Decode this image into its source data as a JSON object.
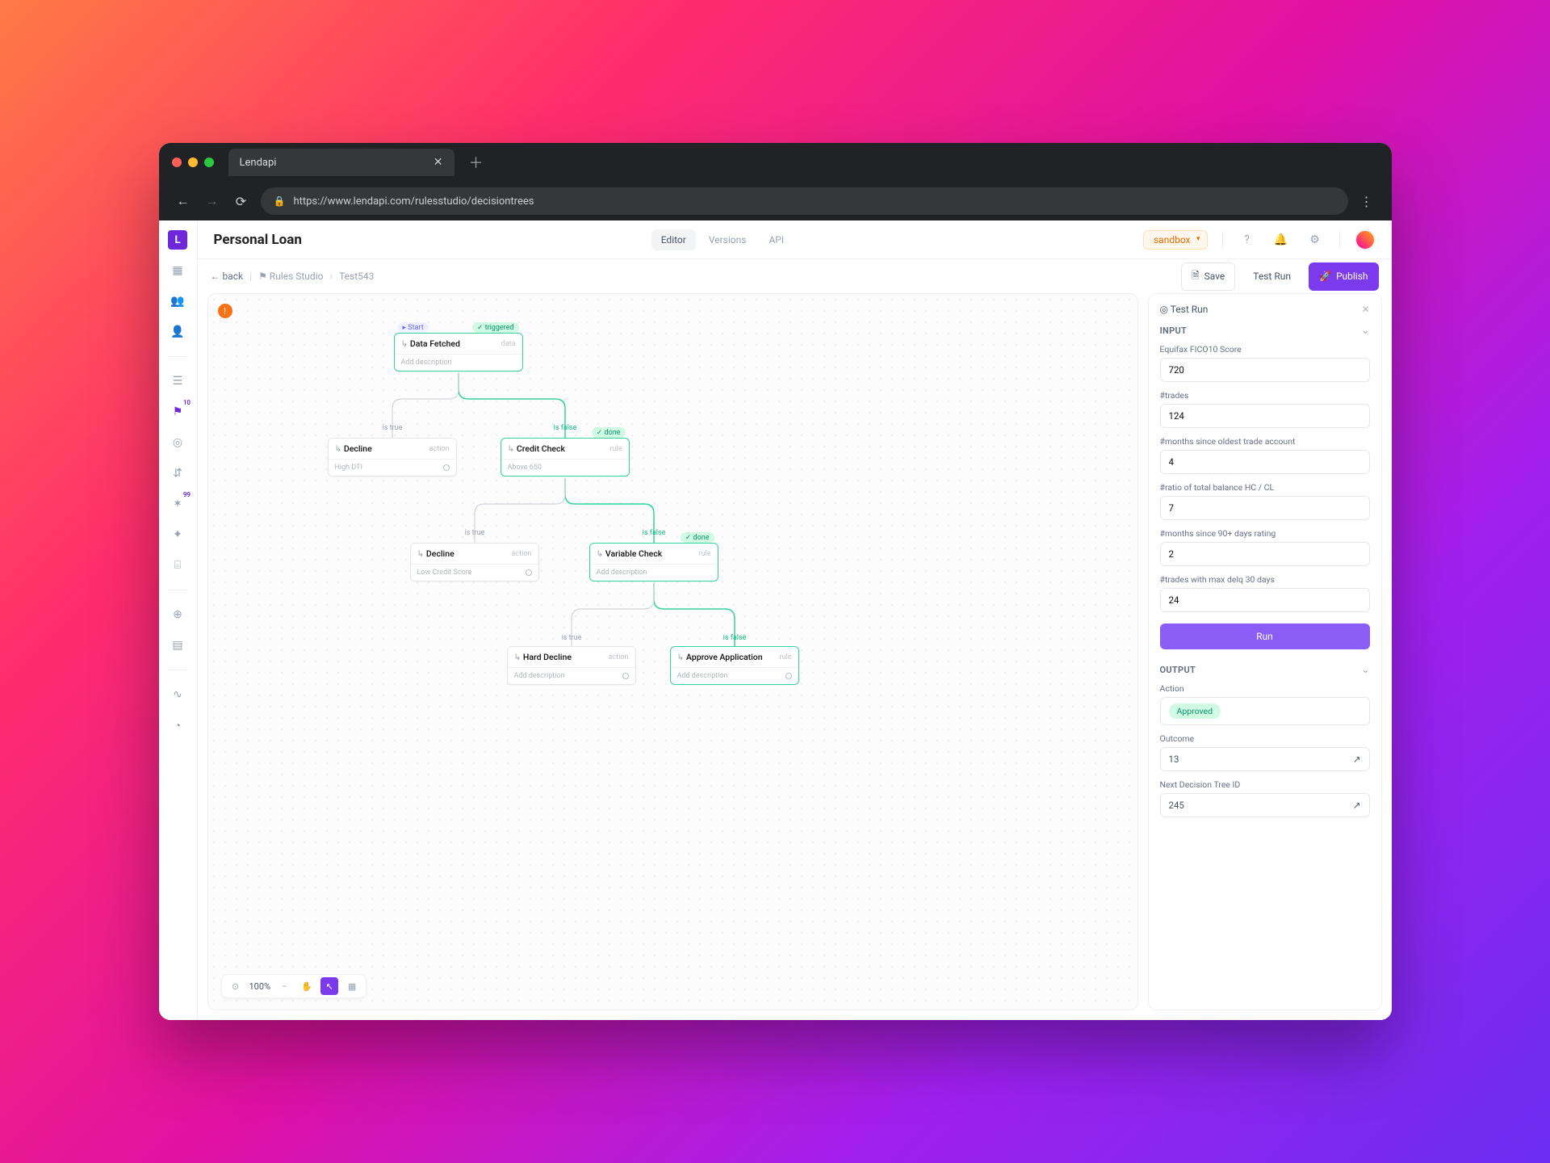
{
  "browser": {
    "tab_title": "Lendapi",
    "url": "https://www.lendapi.com/rulesstudio/decisiontrees"
  },
  "header": {
    "page_title": "Personal Loan",
    "tabs": {
      "editor": "Editor",
      "versions": "Versions",
      "api": "API"
    },
    "env": "sandbox"
  },
  "toolbar": {
    "back": "back",
    "crumb_root": "Rules Studio",
    "crumb_leaf": "Test543",
    "save": "Save",
    "test_run": "Test Run",
    "publish": "Publish"
  },
  "rail": {
    "badge_count": "10",
    "tool_badge": "99"
  },
  "canvas": {
    "zoom_label": "100%"
  },
  "nodes": {
    "start": {
      "title": "Data Fetched",
      "meta": "data",
      "sub": "Add description",
      "badge": "triggered",
      "start_label": "Start"
    },
    "decline1": {
      "title": "Decline",
      "meta": "action",
      "sub": "High DTI"
    },
    "credit": {
      "title": "Credit Check",
      "meta": "rule",
      "sub": "Above 650",
      "badge": "done"
    },
    "decline2": {
      "title": "Decline",
      "meta": "action",
      "sub": "Low Credit Score"
    },
    "variable": {
      "title": "Variable Check",
      "meta": "rule",
      "sub": "Add description",
      "badge": "done"
    },
    "hard": {
      "title": "Hard Decline",
      "meta": "action",
      "sub": "Add description"
    },
    "approve": {
      "title": "Approve Application",
      "meta": "rule",
      "sub": "Add description"
    }
  },
  "edges": {
    "is_true": "is true",
    "is_false": "is false"
  },
  "testrun": {
    "panel_title": "Test Run",
    "input_heading": "INPUT",
    "output_heading": "OUTPUT",
    "inputs": {
      "fico": {
        "label": "Equifax FICO10 Score",
        "value": "720"
      },
      "trades": {
        "label": "#trades",
        "value": "124"
      },
      "months_oldest": {
        "label": "#months since oldest trade account",
        "value": "4"
      },
      "ratio": {
        "label": "#ratio of total balance HC / CL",
        "value": "7"
      },
      "months_90": {
        "label": "#months since 90+ days rating",
        "value": "2"
      },
      "max_delq": {
        "label": "#trades with max delq 30 days",
        "value": "24"
      }
    },
    "run_label": "Run",
    "outputs": {
      "action": {
        "label": "Action",
        "value": "Approved"
      },
      "outcome": {
        "label": "Outcome",
        "value": "13"
      },
      "next_id": {
        "label": "Next Decision Tree ID",
        "value": "245"
      }
    }
  }
}
